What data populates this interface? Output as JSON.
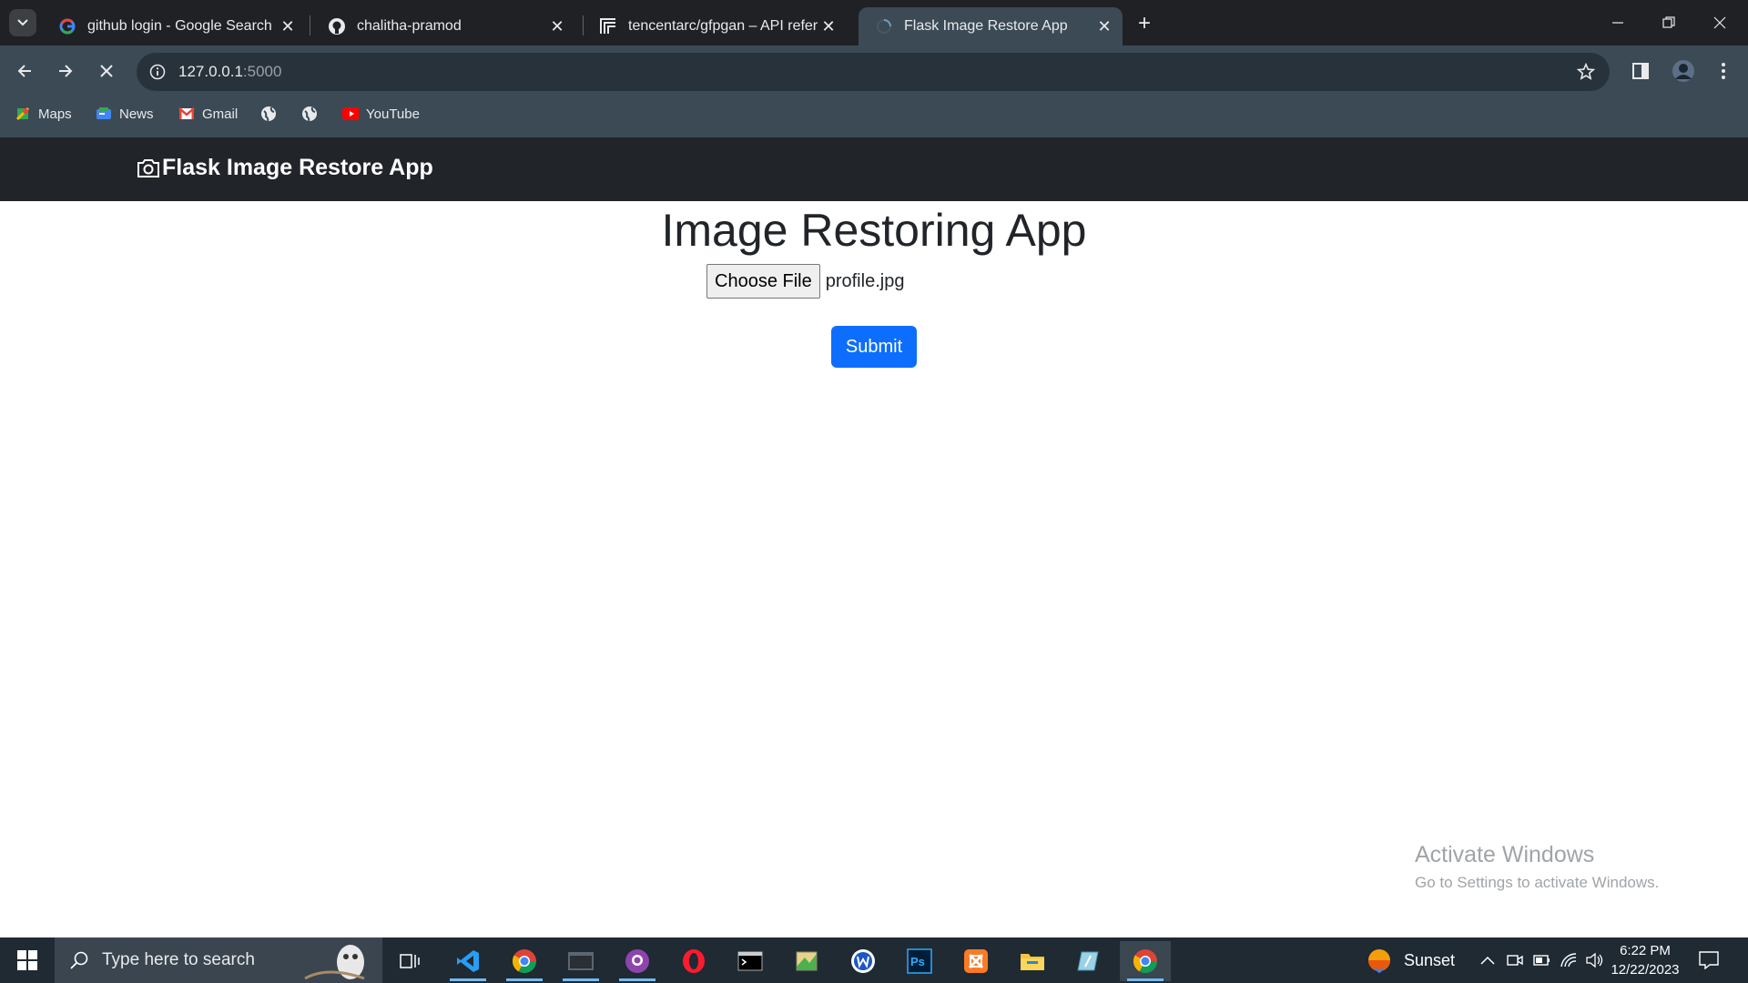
{
  "browser": {
    "tabs": [
      {
        "title": "github login - Google Search",
        "icon": "google-icon"
      },
      {
        "title": "chalitha-pramod",
        "icon": "github-icon"
      },
      {
        "title": "tencentarc/gfpgan – API reference",
        "icon": "replicate-icon"
      },
      {
        "title": "Flask Image Restore App",
        "icon": "loading-spinner-icon",
        "active": true
      }
    ],
    "address": {
      "host": "127.0.0.1",
      "port": ":5000"
    },
    "bookmarks": [
      {
        "label": "Maps",
        "icon": "maps-icon"
      },
      {
        "label": "News",
        "icon": "news-icon"
      },
      {
        "label": "Gmail",
        "icon": "gmail-icon"
      },
      {
        "label": "",
        "icon": "globe-icon"
      },
      {
        "label": "",
        "icon": "globe-icon"
      },
      {
        "label": "YouTube",
        "icon": "youtube-icon"
      }
    ]
  },
  "app": {
    "brand": "Flask Image Restore App",
    "heading": "Image Restoring App",
    "choose_file_label": "Choose File",
    "file_name": "profile.jpg",
    "submit_label": "Submit"
  },
  "watermark": {
    "line1": "Activate Windows",
    "line2": "Go to Settings to activate Windows."
  },
  "taskbar": {
    "search_placeholder": "Type here to search",
    "weather": "Sunset",
    "time": "6:22 PM",
    "date": "12/22/2023"
  },
  "colors": {
    "chrome_dark": "#202124",
    "chrome_toolbar": "#3c4a55",
    "navbar": "#212529",
    "primary": "#0d6efd",
    "taskbar": "#1f2a33"
  }
}
